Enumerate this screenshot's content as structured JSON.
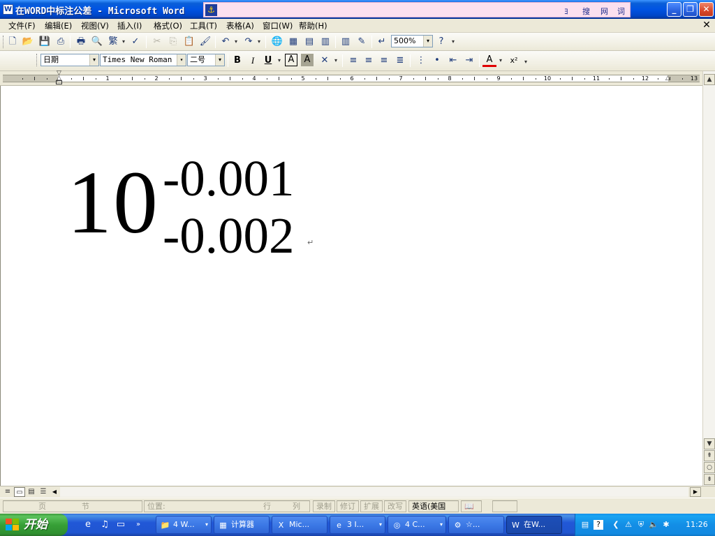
{
  "window": {
    "title": "在WORD中标注公差 - Microsoft Word",
    "doc_icon": "W",
    "ime": {
      "logo": "⚓",
      "items": [
        "ﾖ",
        "搜",
        "网",
        "词"
      ]
    },
    "controls": {
      "minimize": "_",
      "restore": "❐",
      "close": "✕"
    }
  },
  "menu": {
    "items": [
      "文件(F)",
      "编辑(E)",
      "视图(V)",
      "插入(I)",
      "格式(O)",
      "工具(T)",
      "表格(A)",
      "窗口(W)",
      "帮助(H)"
    ],
    "close": "✕"
  },
  "standard_toolbar": {
    "buttons": [
      {
        "name": "new-icon",
        "glyph": "🗋"
      },
      {
        "name": "open-icon",
        "glyph": "📂"
      },
      {
        "name": "save-icon",
        "glyph": "💾"
      },
      {
        "name": "permission-icon",
        "glyph": "⎙"
      },
      {
        "name": "print-icon",
        "glyph": "🖶"
      },
      {
        "name": "print-preview-icon",
        "glyph": "🔍"
      },
      {
        "name": "chinese-conversion-icon",
        "glyph": "繁"
      },
      {
        "name": "spelling-icon",
        "glyph": "✓"
      },
      {
        "name": "cut-icon",
        "glyph": "✂"
      },
      {
        "name": "copy-icon",
        "glyph": "⎘"
      },
      {
        "name": "paste-icon",
        "glyph": "📋"
      },
      {
        "name": "format-painter-icon",
        "glyph": "🖌"
      },
      {
        "name": "undo-icon",
        "glyph": "↶"
      },
      {
        "name": "redo-icon",
        "glyph": "↷"
      },
      {
        "name": "hyperlink-icon",
        "glyph": "🌐"
      },
      {
        "name": "tables-borders-icon",
        "glyph": "▦"
      },
      {
        "name": "insert-table-icon",
        "glyph": "▤"
      },
      {
        "name": "insert-excel-icon",
        "glyph": "▥"
      },
      {
        "name": "columns-icon",
        "glyph": "▥"
      },
      {
        "name": "drawing-icon",
        "glyph": "✎"
      },
      {
        "name": "show-hide-icon",
        "glyph": "↵"
      },
      {
        "name": "help-icon",
        "glyph": "?"
      }
    ],
    "zoom": "500%"
  },
  "format_toolbar": {
    "style": "日期",
    "font": "Times New Roman",
    "size": "二号",
    "buttons": [
      {
        "name": "bold-icon",
        "glyph": "B"
      },
      {
        "name": "italic-icon",
        "glyph": "I"
      },
      {
        "name": "underline-icon",
        "glyph": "U"
      },
      {
        "name": "char-border-icon",
        "glyph": "A"
      },
      {
        "name": "char-shading-icon",
        "glyph": "A"
      },
      {
        "name": "char-scaling-icon",
        "glyph": "✕"
      },
      {
        "name": "align-left-icon",
        "glyph": "≡"
      },
      {
        "name": "align-center-icon",
        "glyph": "≡"
      },
      {
        "name": "align-right-icon",
        "glyph": "≡"
      },
      {
        "name": "justify-icon",
        "glyph": "≣"
      },
      {
        "name": "numbering-icon",
        "glyph": "⋮"
      },
      {
        "name": "bullets-icon",
        "glyph": "•"
      },
      {
        "name": "decrease-indent-icon",
        "glyph": "⇤"
      },
      {
        "name": "increase-indent-icon",
        "glyph": "⇥"
      },
      {
        "name": "font-color-icon",
        "glyph": "A"
      },
      {
        "name": "superscript-icon",
        "glyph": "x²"
      }
    ]
  },
  "ruler": {
    "numbers": [
      "1",
      "2",
      "3",
      "4",
      "5",
      "6",
      "7",
      "8",
      "9",
      "10",
      "11",
      "12",
      "13"
    ]
  },
  "document": {
    "base": "10",
    "upper": "-0.001",
    "lower": "-0.002",
    "para_mark": "↵"
  },
  "view_buttons": [
    "≡",
    "▭",
    "▤",
    "☰"
  ],
  "status": {
    "page": "页",
    "section": "节",
    "position": "位置:",
    "line": "行",
    "column": "列",
    "modes": [
      "录制",
      "修订",
      "扩展",
      "改写"
    ],
    "language": "英语(美国"
  },
  "taskbar": {
    "start": "开始",
    "tasks": [
      {
        "label": "4 W...",
        "icon": "📁"
      },
      {
        "label": "计算器",
        "icon": "▦"
      },
      {
        "label": "Mic...",
        "icon": "X"
      },
      {
        "label": "3 I...",
        "icon": "e"
      },
      {
        "label": "4 C...",
        "icon": "◎"
      },
      {
        "label": "☆...",
        "icon": "⚙"
      },
      {
        "label": "在W...",
        "icon": "W"
      }
    ],
    "clock": "11:26"
  },
  "colors": {
    "title_blue": "#0054e3",
    "taskbar_blue": "#2157d7",
    "start_green": "#37a037",
    "tray_blue": "#138ee6"
  }
}
